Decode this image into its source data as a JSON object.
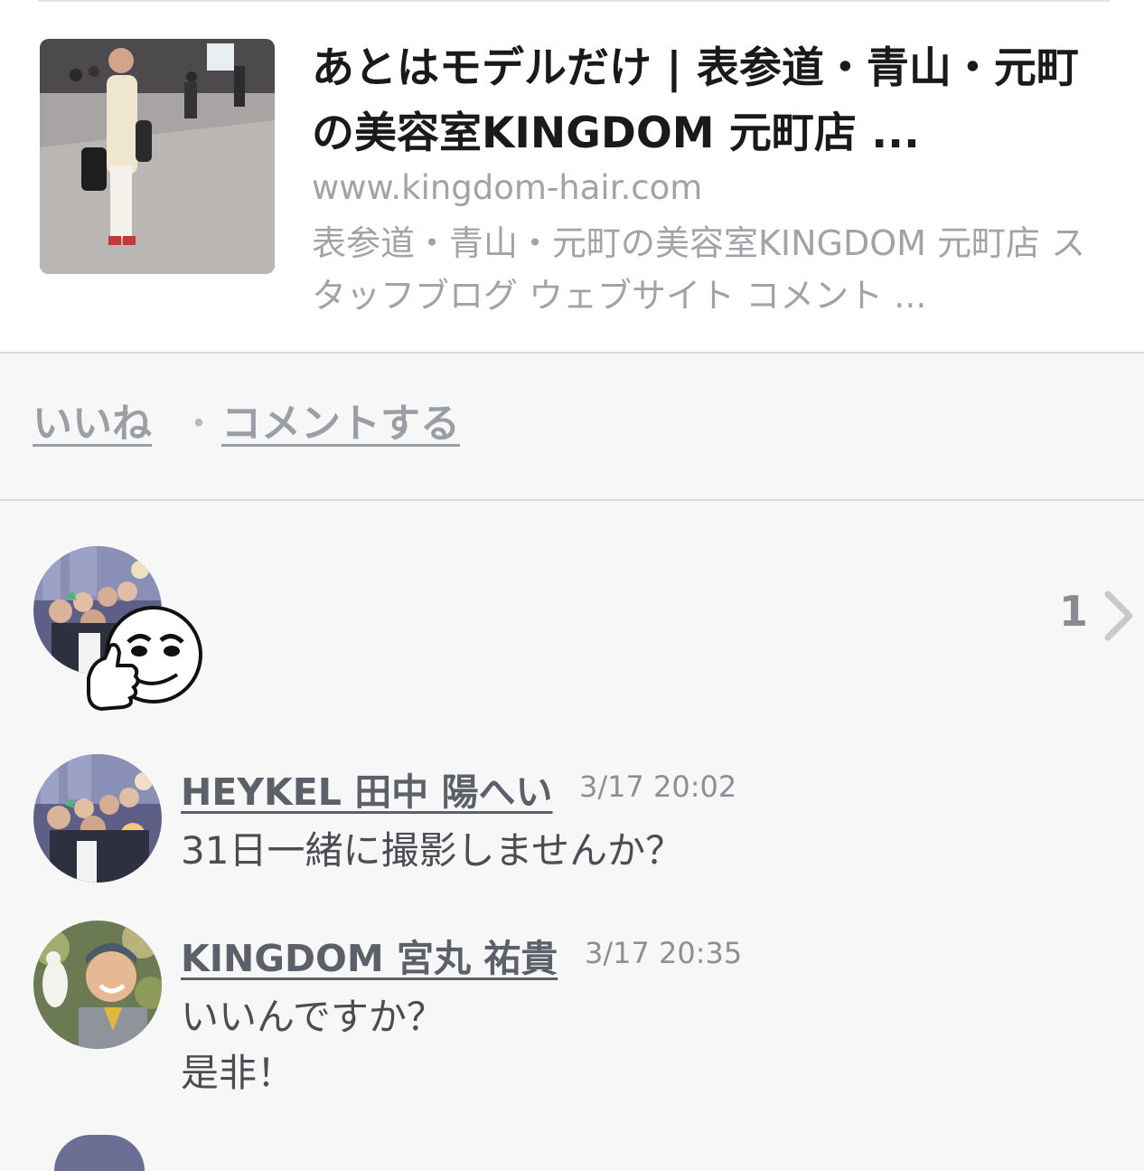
{
  "link_card": {
    "title": "あとはモデルだけ | 表参道・青山・元町の美容室KINGDOM 元町店 ...",
    "url": "www.kingdom-hair.com",
    "description": "表参道・青山・元町の美容室KINGDOM 元町店 スタッフブログ ウェブサイト コメント ...",
    "thumbnail_icon": "photo-man-in-station"
  },
  "actions": {
    "like_label": "いいね",
    "separator": "・",
    "comment_label": "コメントする"
  },
  "likes": {
    "count": "1",
    "sticker_icon": "thumbs-up-face-sticker",
    "chevron_icon": "chevron-right-icon"
  },
  "comments": [
    {
      "author": "HEYKEL 田中 陽へい",
      "time": "3/17 20:02",
      "text": "31日一緒に撮影しませんか？"
    },
    {
      "author": "KINGDOM 宮丸 祐貴",
      "time": "3/17 20:35",
      "text": "いいんですか？\n是非！"
    }
  ],
  "colors": {
    "background": "#f7f7f7",
    "card_bg": "#ffffff",
    "link_gray": "#9a9ea5",
    "title": "#1a1a1a"
  }
}
